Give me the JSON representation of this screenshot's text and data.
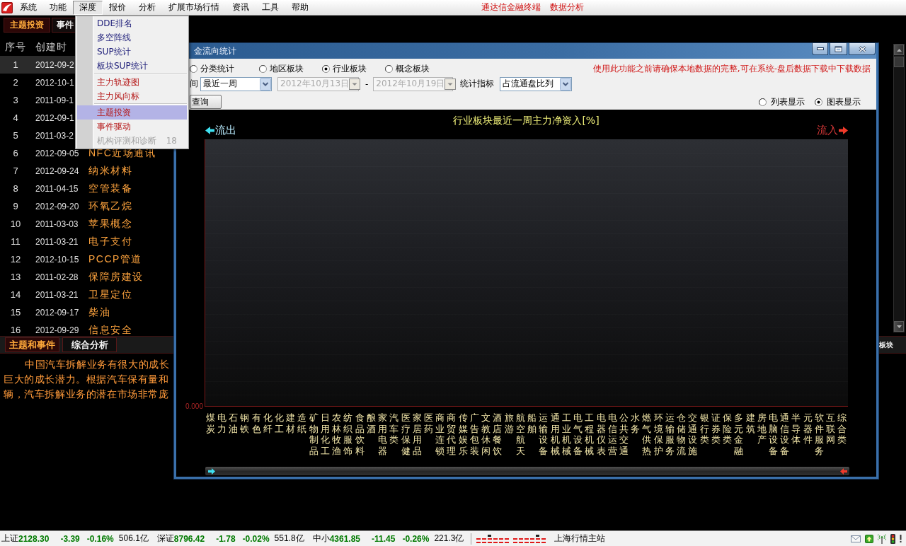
{
  "menubar": {
    "items": [
      {
        "label": "系统",
        "selected": false
      },
      {
        "label": "功能",
        "selected": false
      },
      {
        "label": "深度",
        "selected": true
      },
      {
        "label": "报价",
        "selected": false
      },
      {
        "label": "分析",
        "selected": false
      },
      {
        "label": "扩展市场行情",
        "selected": false
      },
      {
        "label": "资讯",
        "selected": false
      },
      {
        "label": "工具",
        "selected": false
      },
      {
        "label": "帮助",
        "selected": false
      }
    ],
    "links": [
      "通达信金融终端",
      "数据分析"
    ]
  },
  "dropdown_menu": {
    "sections": [
      {
        "items": [
          {
            "label": "DDE排名",
            "kind": "standard",
            "selected": false,
            "disabled": false
          },
          {
            "label": "多空阵线",
            "kind": "standard",
            "selected": false,
            "disabled": false
          },
          {
            "label": "SUP统计",
            "kind": "standard",
            "selected": false,
            "disabled": false
          },
          {
            "label": "板块SUP统计",
            "kind": "standard",
            "selected": false,
            "disabled": false
          }
        ]
      },
      {
        "items": [
          {
            "label": "主力轨迹图",
            "kind": "featured",
            "selected": false,
            "disabled": false
          },
          {
            "label": "主力风向标",
            "kind": "featured",
            "selected": false,
            "disabled": false
          }
        ]
      },
      {
        "items": [
          {
            "label": "主题投资",
            "kind": "featured",
            "selected": true,
            "disabled": false
          },
          {
            "label": "事件驱动",
            "kind": "featured",
            "selected": false,
            "disabled": false
          },
          {
            "label": "机构评测和诊断",
            "shortcut": "18",
            "selected": false,
            "disabled": true
          }
        ]
      }
    ]
  },
  "top_tabs": [
    {
      "label": "主题投资",
      "selected": true
    },
    {
      "label": "事件",
      "selected": false
    }
  ],
  "theme_list": {
    "columns": [
      "序号",
      "创建时"
    ],
    "rows": [
      {
        "number": "1",
        "date": "2012-09-2",
        "selected": true
      },
      {
        "number": "2",
        "date": "2012-10-1",
        "selected": false
      },
      {
        "number": "3",
        "date": "2011-09-1",
        "selected": false
      },
      {
        "number": "4",
        "date": "2012-09-1",
        "selected": false
      },
      {
        "number": "5",
        "date": "2011-03-2",
        "selected": false
      },
      {
        "number": "6",
        "date": "2012-09-05",
        "name": "NFC近场通讯",
        "selected": false
      },
      {
        "number": "7",
        "date": "2012-09-24",
        "name": "纳米材料",
        "selected": false
      },
      {
        "number": "8",
        "date": "2011-04-15",
        "name": "空管装备",
        "selected": false
      },
      {
        "number": "9",
        "date": "2012-09-20",
        "name": "环氧乙烷",
        "selected": false
      },
      {
        "number": "10",
        "date": "2011-03-03",
        "name": "苹果概念",
        "selected": false
      },
      {
        "number": "11",
        "date": "2011-03-21",
        "name": "电子支付",
        "selected": false
      },
      {
        "number": "12",
        "date": "2012-10-15",
        "name": "PCCP管道",
        "selected": false
      },
      {
        "number": "13",
        "date": "2011-02-28",
        "name": "保障房建设",
        "selected": false
      },
      {
        "number": "14",
        "date": "2011-03-21",
        "name": "卫星定位",
        "selected": false
      },
      {
        "number": "15",
        "date": "2012-09-17",
        "name": "柴油",
        "selected": false
      },
      {
        "number": "16",
        "date": "2012-09-29",
        "name": "信息安全",
        "selected": false
      }
    ]
  },
  "dialog": {
    "title": "金流向统计",
    "scope_options": [
      {
        "label": "分类统计",
        "selected": false
      },
      {
        "label": "地区板块",
        "selected": false
      },
      {
        "label": "行业板块",
        "selected": true
      },
      {
        "label": "概念板块",
        "selected": false
      }
    ],
    "notice": "使用此功能之前请确保本地数据的完整,可在系统-盘后数据下载中下载数据",
    "period_label": "间",
    "period": "最近一周",
    "date_from": {
      "value": "2012年10月13日",
      "disabled": true
    },
    "date_separator": "-",
    "date_to": {
      "value": "2012年10月19日",
      "disabled": true
    },
    "metric_label": "统计指标",
    "metric": "占流通盘比列",
    "query_button": "查询",
    "view_options": [
      {
        "label": "列表显示",
        "selected": false
      },
      {
        "label": "图表显示",
        "selected": true
      }
    ],
    "chart": {
      "title": "行业板块最近一周主力净资入[%]",
      "outflow_label": "流出",
      "inflow_label": "流入",
      "y_tick": "0.000",
      "categories": [
        "煤炭",
        "电力",
        "石油",
        "钢铁",
        "有色",
        "化纤",
        "化工",
        "建材",
        "造纸",
        "矿物制品",
        "日用化工",
        "农林牧渔",
        "纺织服饰",
        "食品饮料",
        "酿酒",
        "家用电器",
        "汽车类",
        "医疗保健",
        "家居用品",
        "医药",
        "商业连锁",
        "商贸代理",
        "传媒娱乐",
        "广告包装",
        "文教休闲",
        "酒店餐饮",
        "旅游",
        "航空航天",
        "船舶",
        "运输设备",
        "通用机械",
        "工业机械",
        "电气设备",
        "工程机械",
        "电器仪表",
        "电信运营",
        "公共交通",
        "水务",
        "燃气供热",
        "环境保护",
        "运输服务",
        "仓储物流",
        "交通设施",
        "银行类",
        "证券类",
        "保险类",
        "多元金融",
        "建筑",
        "房地产",
        "电脑设备",
        "通信设备",
        "半导体",
        "元器件",
        "软件服务",
        "互联网",
        "综合类"
      ]
    }
  },
  "bottom_panel": {
    "tabs": [
      {
        "label": "主题和事件",
        "selected": true
      },
      {
        "label": "综合分析",
        "selected": false
      }
    ],
    "right_tab": "板块",
    "text_lines": [
      {
        "text": "中国汽车拆解业务有很大的成长",
        "indented": true
      },
      {
        "text": "巨大的成长潜力。根据汽车保有量和",
        "indented": false
      },
      {
        "text": "辆，汽车拆解业务的潜在市场非常庞",
        "indented": false
      }
    ]
  },
  "status_bar": {
    "indices": [
      {
        "name": "上证",
        "value": "2128.30",
        "change": "-3.39",
        "percent": "-0.16%",
        "amount": "506.1亿",
        "falling": true
      },
      {
        "name": "深证",
        "value": "8796.42",
        "change": "-1.78",
        "percent": "-0.02%",
        "amount": "551.8亿",
        "falling": true
      },
      {
        "name": "中小",
        "value": "4361.85",
        "change": "-11.45",
        "percent": "-0.26%",
        "amount": "221.3亿",
        "falling": true
      }
    ],
    "server": "上海行情主站"
  }
}
